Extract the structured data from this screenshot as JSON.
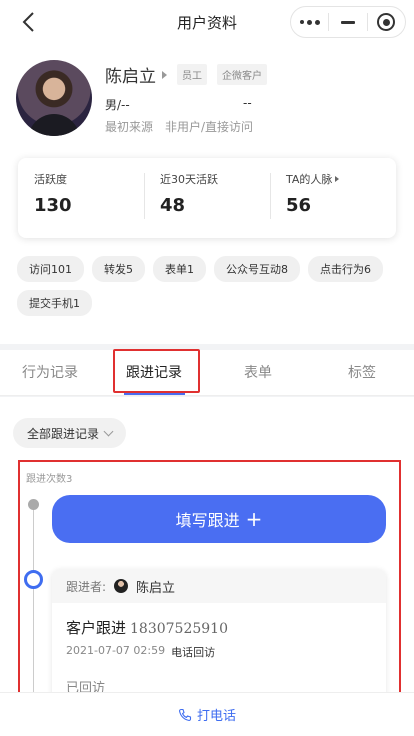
{
  "nav": {
    "title": "用户资料"
  },
  "profile": {
    "name": "陈启立",
    "tags": [
      "员工",
      "企微客户"
    ],
    "gender": "男/--",
    "gender_extra": "--",
    "source_label": "最初来源",
    "source_value": "非用户/直接访问"
  },
  "stats": [
    {
      "label": "活跃度",
      "value": "130"
    },
    {
      "label": "近30天活跃",
      "value": "48"
    },
    {
      "label": "TA的人脉",
      "value": "56"
    }
  ],
  "chips": [
    "访问101",
    "转发5",
    "表单1",
    "公众号互动8",
    "点击行为6",
    "提交手机1"
  ],
  "tabs": [
    "行为记录",
    "跟进记录",
    "表单",
    "标签"
  ],
  "active_tab": "跟进记录",
  "filter": {
    "label": "全部跟进记录"
  },
  "followup": {
    "count_label": "跟进次数3",
    "button_label": "填写跟进",
    "follower_label": "跟进者:",
    "follower_name": "陈启立",
    "record_title": "客户跟进",
    "record_phone": "18307525910",
    "record_time": "2021-07-07 02:59",
    "record_type": "电话回访",
    "record_status": "已回访"
  },
  "call_bar": {
    "label": "打电话"
  },
  "colors": {
    "accent": "#4a6ef2",
    "highlight": "#e03030"
  }
}
